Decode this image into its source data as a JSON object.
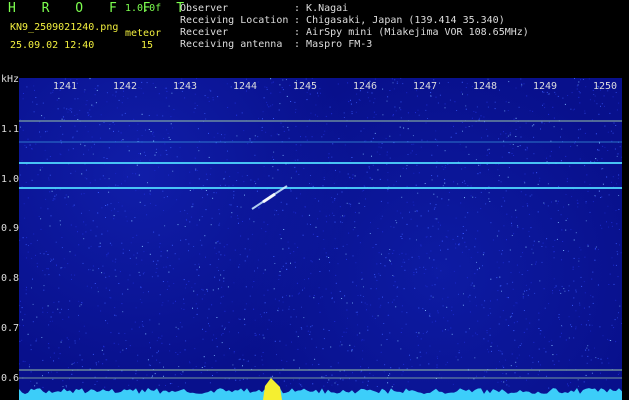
{
  "header": {
    "app_title": "H R O F F T",
    "version": "1.0.0f",
    "file_name": "KN9_2509021240.png",
    "mode_label": "meteor",
    "date_time": "25.09.02 12:40",
    "count_value": "15"
  },
  "info": [
    {
      "key": "Observer",
      "value": "K.Nagai"
    },
    {
      "key": "Receiving Location",
      "value": "Chigasaki, Japan (139.414 35.340)"
    },
    {
      "key": "Receiver",
      "value": "AirSpy mini (Miakejima VOR 108.65MHz)"
    },
    {
      "key": "Receiving antenna",
      "value": "Maspro FM-3"
    }
  ],
  "axis": {
    "unit": "kHz",
    "x_ticks": [
      "1241",
      "1242",
      "1243",
      "1244",
      "1245",
      "1246",
      "1247",
      "1248",
      "1249",
      "1250"
    ],
    "y_ticks": [
      "1.1",
      "1.0",
      "0.9",
      "0.8",
      "0.7",
      "0.6"
    ]
  },
  "colors": {
    "background": "#08108c",
    "signal_line": "#4fd6ff",
    "marker_line": "#bff2a8",
    "meteor": "#cfefff",
    "baseline_fill": "#3fd8ff",
    "baseline_peak": "#f5ef30"
  }
}
